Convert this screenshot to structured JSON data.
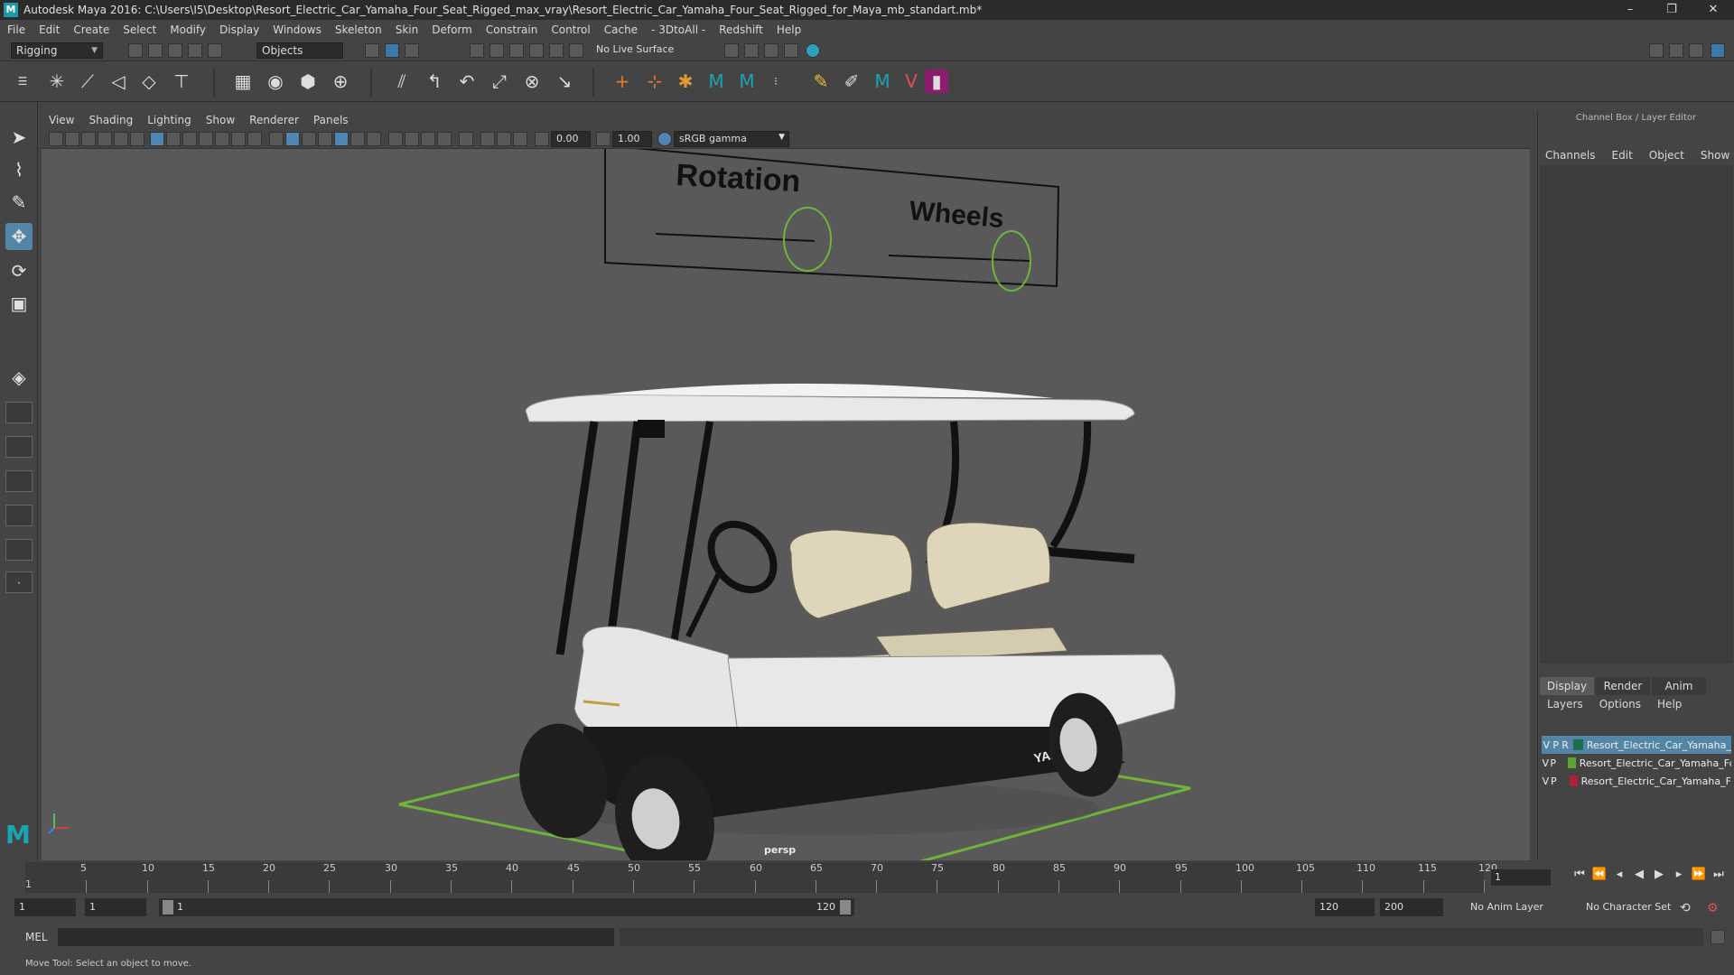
{
  "titlebar": {
    "title": "Autodesk Maya 2016: C:\\Users\\I5\\Desktop\\Resort_Electric_Car_Yamaha_Four_Seat_Rigged_max_vray\\Resort_Electric_Car_Yamaha_Four_Seat_Rigged_for_Maya_mb_standart.mb*",
    "minimize": "–",
    "restore": "❐",
    "close": "✕"
  },
  "menu": [
    "File",
    "Edit",
    "Create",
    "Select",
    "Modify",
    "Display",
    "Windows",
    "Skeleton",
    "Skin",
    "Deform",
    "Constrain",
    "Control",
    "Cache",
    "- 3DtoAll -",
    "Redshift",
    "Help"
  ],
  "statusline": {
    "menuset": "Rigging",
    "select_mode": "Objects",
    "live_surface": "No Live Surface"
  },
  "viewport": {
    "menu": [
      "View",
      "Shading",
      "Lighting",
      "Show",
      "Renderer",
      "Panels"
    ],
    "exposure": "0.00",
    "gamma": "1.00",
    "colorspace": "sRGB gamma",
    "camera_label": "persp",
    "board": {
      "label_rotation": "Rotation",
      "label_wheels": "Wheels"
    },
    "brand": "YAMAHA"
  },
  "channelbox": {
    "title": "Channel Box / Layer Editor",
    "menu": [
      "Channels",
      "Edit",
      "Object",
      "Show"
    ],
    "tabs": [
      "Display",
      "Render",
      "Anim"
    ],
    "layer_menu": [
      "Layers",
      "Options",
      "Help"
    ],
    "layers": [
      {
        "v": "V",
        "p": "P",
        "r": "R",
        "color": "#1c6e4e",
        "name": "Resort_Electric_Car_Yamaha_Four_Seat"
      },
      {
        "v": "V",
        "p": "P",
        "r": "",
        "color": "#5aa630",
        "name": "Resort_Electric_Car_Yamaha_Four_Seat_Controllers"
      },
      {
        "v": "V",
        "p": "P",
        "r": "",
        "color": "#b0203a",
        "name": "Resort_Electric_Car_Yamaha_Four_Seat_Helpers"
      }
    ]
  },
  "timeline": {
    "ticks": [
      "5",
      "10",
      "15",
      "20",
      "25",
      "30",
      "35",
      "40",
      "45",
      "50",
      "55",
      "60",
      "65",
      "70",
      "75",
      "80",
      "85",
      "90",
      "95",
      "100",
      "105",
      "110",
      "115",
      "120"
    ],
    "start_marker": "1",
    "current_frame": "1"
  },
  "range": {
    "start": "1",
    "playback_start": "1",
    "slider_start": "1",
    "slider_end": "120",
    "playback_end": "120",
    "end": "200",
    "anim_layer": "No Anim Layer",
    "character_set": "No Character Set"
  },
  "cmdline": {
    "label": "MEL"
  },
  "helpline": {
    "text": "Move Tool: Select an object to move."
  }
}
